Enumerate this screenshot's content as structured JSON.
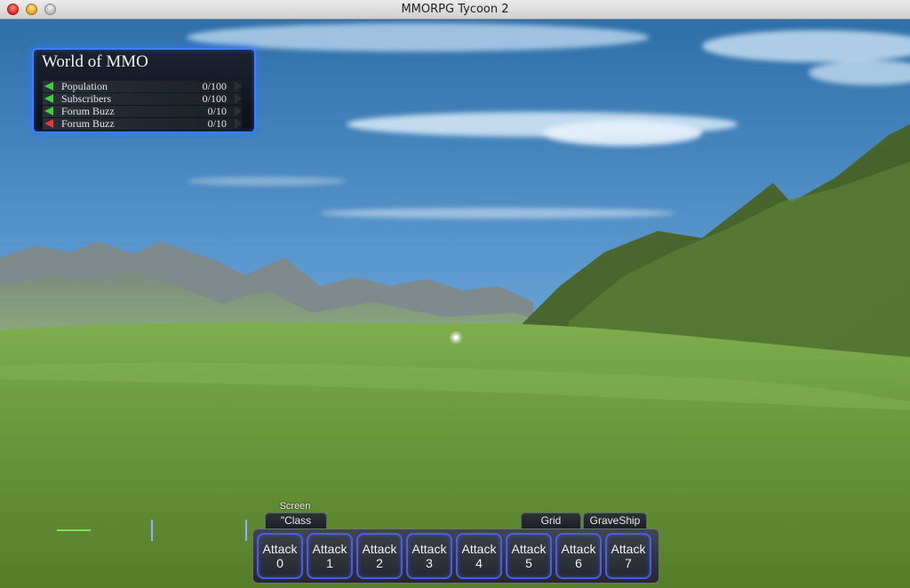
{
  "window": {
    "title": "MMORPG Tycoon 2"
  },
  "stats_panel": {
    "world_name": "World of MMO",
    "rows": [
      {
        "label": "Population",
        "value": "0/100",
        "trend": "up",
        "color": "#36d33a"
      },
      {
        "label": "Subscribers",
        "value": "0/100",
        "trend": "up",
        "color": "#36d33a"
      },
      {
        "label": "Forum Buzz",
        "value": "0/10",
        "trend": "up",
        "color": "#36d33a"
      },
      {
        "label": "Forum Buzz",
        "value": "0/10",
        "trend": "down",
        "color": "#e03a3a"
      }
    ]
  },
  "hud": {
    "screen_label": "Screen",
    "tabs": {
      "class": "\"Class",
      "grid": "Grid",
      "graveship": "GraveShip"
    },
    "slots": [
      {
        "line1": "Attack",
        "line2": "0"
      },
      {
        "line1": "Attack 1",
        "line2": ""
      },
      {
        "line1": "Attack",
        "line2": "2"
      },
      {
        "line1": "Attack",
        "line2": "3"
      },
      {
        "line1": "Attack",
        "line2": "4"
      },
      {
        "line1": "Attack",
        "line2": "5"
      },
      {
        "line1": "Attack",
        "line2": "6"
      },
      {
        "line1": "Attack",
        "line2": "7"
      }
    ]
  },
  "colors": {
    "accent": "#3d7dff",
    "slot_border": "#4a5cf0",
    "trend_up": "#36d33a",
    "trend_down": "#e03a3a"
  }
}
